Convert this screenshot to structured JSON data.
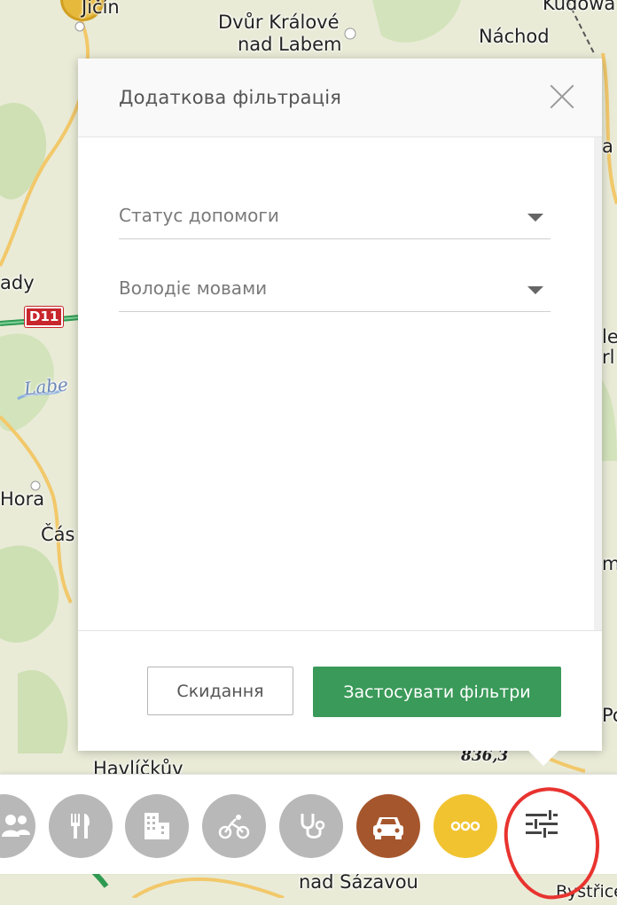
{
  "map": {
    "places": [
      {
        "id": "jicin",
        "text": "Jičín"
      },
      {
        "id": "dvur",
        "text": "Dvůr Králové"
      },
      {
        "id": "nadlabem",
        "text": "nad Labem"
      },
      {
        "id": "nachod",
        "text": "Náchod"
      },
      {
        "id": "kudowa",
        "text": "Kudowa"
      },
      {
        "id": "ady",
        "text": "ady"
      },
      {
        "id": "hora",
        "text": "Hora"
      },
      {
        "id": "cas",
        "text": "Čás"
      },
      {
        "id": "havlickuv",
        "text": "Havlíčkův"
      },
      {
        "id": "sazavou",
        "text": "nad Sázavou"
      },
      {
        "id": "bystrice",
        "text": "Bystřice"
      },
      {
        "id": "edge_a",
        "text": "a"
      },
      {
        "id": "edge_le",
        "text": "le"
      },
      {
        "id": "edge_rl",
        "text": "rl"
      },
      {
        "id": "edge_my",
        "text": "my"
      },
      {
        "id": "edge_po",
        "text": "Po"
      }
    ],
    "river": "Labe",
    "road": "D11",
    "elevation": "836,3"
  },
  "modal": {
    "title": "Додаткова фільтрація",
    "fields": [
      {
        "placeholder": "Статус допомоги"
      },
      {
        "placeholder": "Володіє мовами"
      }
    ],
    "reset_label": "Скидання",
    "apply_label": "Застосувати фільтри"
  },
  "toolbar": {
    "buttons": [
      {
        "icon": "people-icon",
        "color": "#b8b8b8"
      },
      {
        "icon": "restaurant-icon",
        "color": "#b8b8b8"
      },
      {
        "icon": "building-icon",
        "color": "#b8b8b8"
      },
      {
        "icon": "bicycle-icon",
        "color": "#b8b8b8"
      },
      {
        "icon": "stethoscope-icon",
        "color": "#b8b8b8"
      },
      {
        "icon": "car-icon",
        "color": "#a6562d"
      },
      {
        "icon": "more-icon",
        "color": "#f1c330"
      },
      {
        "icon": "filter-sliders-icon",
        "color": "#ffffff"
      }
    ]
  },
  "colors": {
    "apply_button": "#3a9a59",
    "annotation_circle": "#e8332f"
  }
}
